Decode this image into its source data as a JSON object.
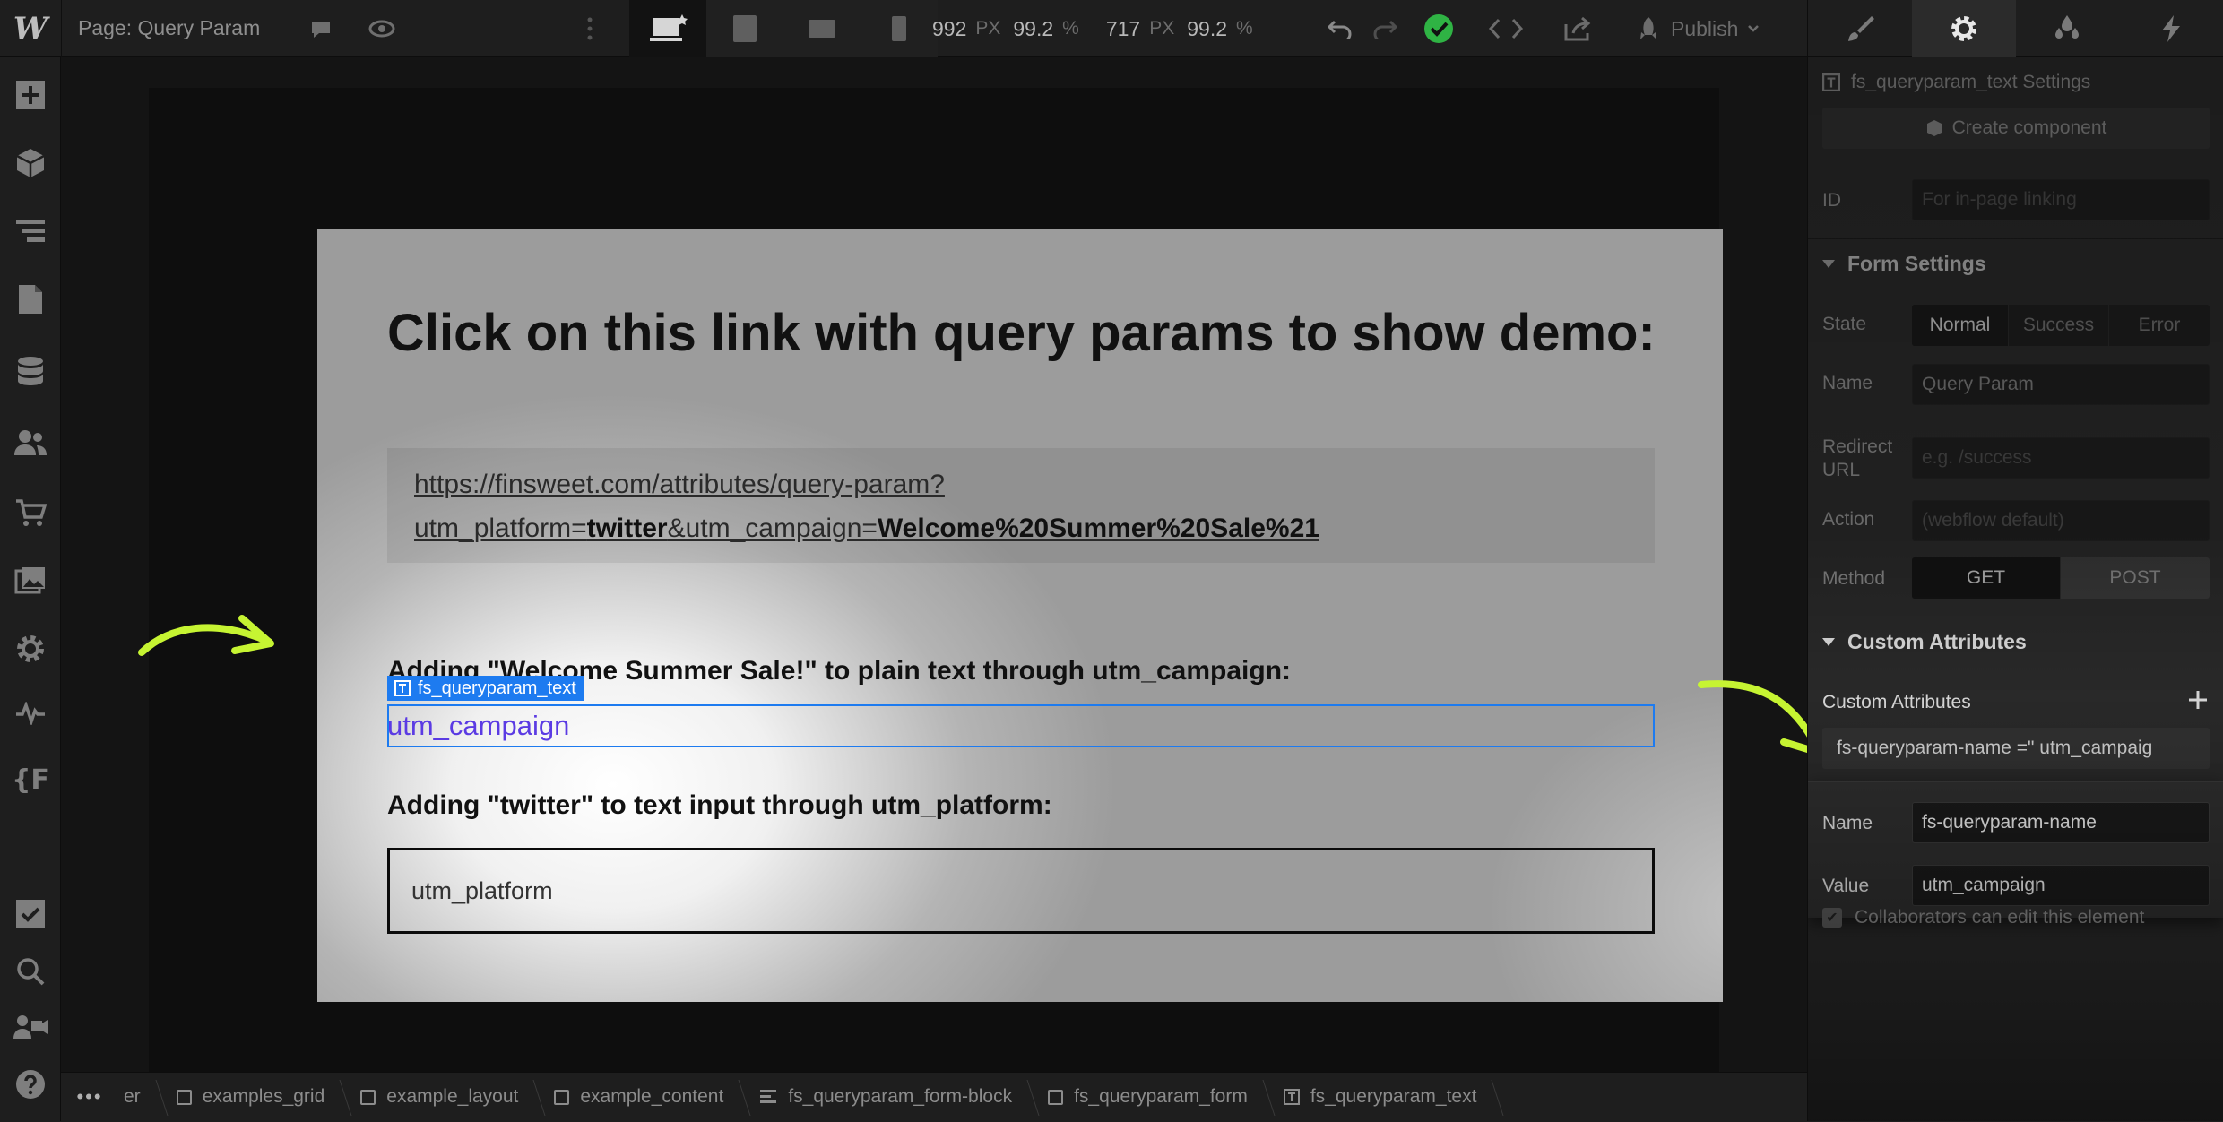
{
  "topbar": {
    "page_label": "Page: Query Param",
    "width_value": "992",
    "width_unit": "PX",
    "width_percent": "99.2",
    "height_value": "717",
    "height_unit": "PX",
    "height_percent": "99.2",
    "percent_unit": "%",
    "publish_label": "Publish"
  },
  "canvas": {
    "heading": "Click on this link with query params to show demo:",
    "link_line1": "https://finsweet.com/attributes/query-param?",
    "link_line2_a": "utm_platform=",
    "link_line2_b": "twitter",
    "link_line2_c": "&utm_campaign=",
    "link_line2_d": "Welcome%20Summer%20Sale%21",
    "subheading1": "Adding \"Welcome Summer Sale!\" to plain text through utm_campaign:",
    "selected_tag": "fs_queryparam_text",
    "selected_text": "utm_campaign",
    "subheading2": "Adding \"twitter\" to text input through utm_platform:",
    "input_text": "utm_platform"
  },
  "breadcrumb": {
    "more": "•••",
    "items": [
      "er",
      "examples_grid",
      "example_layout",
      "example_content",
      "fs_queryparam_form-block",
      "fs_queryparam_form",
      "fs_queryparam_text"
    ]
  },
  "panel": {
    "settings_title": "fs_queryparam_text Settings",
    "create_component": "Create component",
    "id_label": "ID",
    "id_placeholder": "For in-page linking",
    "form_settings": "Form Settings",
    "state_label": "State",
    "state_options": [
      "Normal",
      "Success",
      "Error"
    ],
    "name_label": "Name",
    "name_value": "Query Param",
    "redirect_label": "Redirect URL",
    "redirect_placeholder": "e.g. /success",
    "action_label": "Action",
    "action_placeholder": "(webflow default)",
    "method_label": "Method",
    "method_options": [
      "GET",
      "POST"
    ],
    "custom_attributes": "Custom Attributes",
    "custom_attributes_sub": "Custom Attributes",
    "attribute_summary": "fs-queryparam-name =\" utm_campaig",
    "popup_name_label": "Name",
    "popup_name_value": "fs-queryparam-name",
    "popup_value_label": "Value",
    "popup_value_value": "utm_campaign",
    "collaborators": "Collaborators can edit this element"
  },
  "colors": {
    "accent": "#1d7bf0",
    "arrow": "#c6f432",
    "status_ok": "#2fb344",
    "selected_text": "#5b3be3"
  }
}
